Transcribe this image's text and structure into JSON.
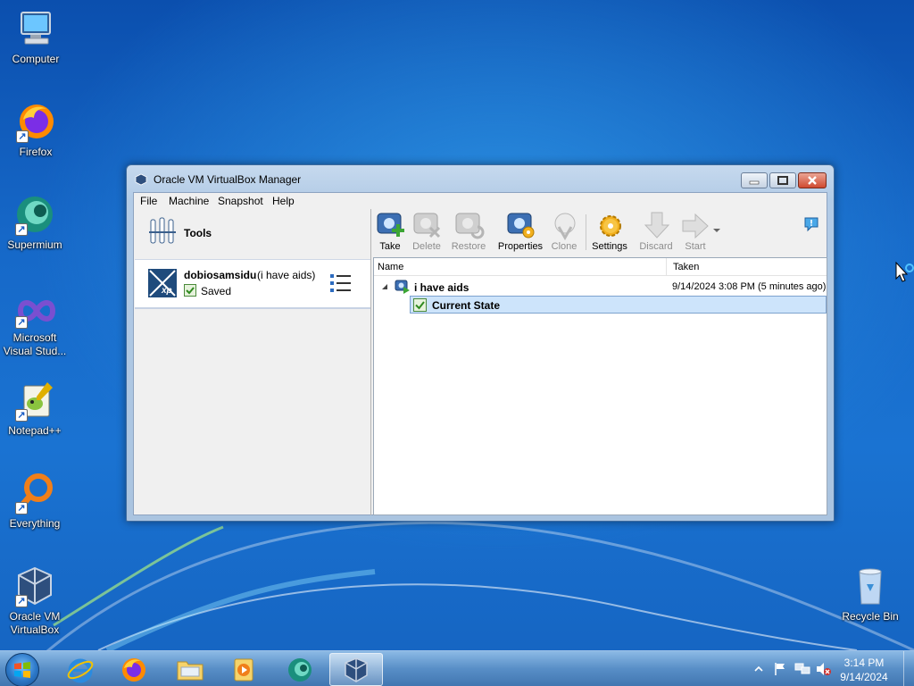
{
  "desktop": {
    "icons": [
      {
        "label": "Computer"
      },
      {
        "label": "Firefox"
      },
      {
        "label": "Supermium"
      },
      {
        "label_line1": "Microsoft",
        "label_line2": "Visual Stud..."
      },
      {
        "label": "Notepad++"
      },
      {
        "label": "Everything"
      },
      {
        "label_line1": "Oracle VM",
        "label_line2": "VirtualBox"
      },
      {
        "label": "Recycle Bin"
      }
    ]
  },
  "window": {
    "title": "Oracle VM VirtualBox Manager",
    "menu": [
      "File",
      "Machine",
      "Snapshot",
      "Help"
    ],
    "tools_label": "Tools",
    "vm": {
      "name": "dobiosamsidu",
      "snapshot_suffix": "(i have aids)",
      "state": "Saved",
      "os_badge": "xp"
    },
    "toolbar": {
      "take": "Take",
      "delete": "Delete",
      "restore": "Restore",
      "properties": "Properties",
      "clone": "Clone",
      "settings": "Settings",
      "discard": "Discard",
      "start": "Start"
    },
    "snapshots": {
      "columns": {
        "name": "Name",
        "taken": "Taken"
      },
      "rows": [
        {
          "name": "i have aids",
          "taken": "9/14/2024 3:08 PM (5 minutes ago)"
        },
        {
          "name": "Current State",
          "taken": ""
        }
      ]
    }
  },
  "taskbar": {
    "time": "3:14 PM",
    "date": "9/14/2024"
  }
}
